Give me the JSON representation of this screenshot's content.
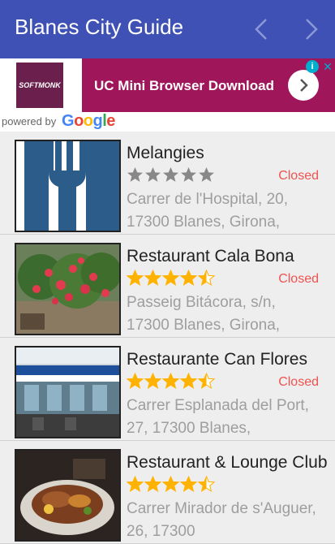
{
  "appbar": {
    "title": "Blanes City Guide",
    "prev_icon": "chevron-left-icon",
    "next_icon": "chevron-right-icon"
  },
  "ad": {
    "brand": "SOFTMONK",
    "text": "UC Mini Browser Download",
    "go_icon": "chevron-right-icon"
  },
  "powered": {
    "by": "powered by",
    "google": "Google"
  },
  "places": [
    {
      "name": "Melangies",
      "rating": 0,
      "status": "Closed",
      "address": "Carrer de l'Hospital, 20, 17300 Blanes, Girona,"
    },
    {
      "name": "Restaurant Cala Bona",
      "rating": 4.5,
      "status": "Closed",
      "address": "Passeig Bitácora, s/n, 17300 Blanes, Girona,"
    },
    {
      "name": "Restaurante Can Flores",
      "rating": 4.5,
      "status": "Closed",
      "address": "Carrer Esplanada del Port, 27, 17300 Blanes,"
    },
    {
      "name": "Restaurant & Lounge Club",
      "rating": 4.5,
      "status": "",
      "address": "Carrer Mirador de s'Auguer, 26, 17300"
    }
  ],
  "colors": {
    "appbar": "#3f51b5",
    "ad": "#a0165b",
    "star_on": "#ffb300",
    "star_off": "#888888",
    "closed": "#ef5350"
  }
}
